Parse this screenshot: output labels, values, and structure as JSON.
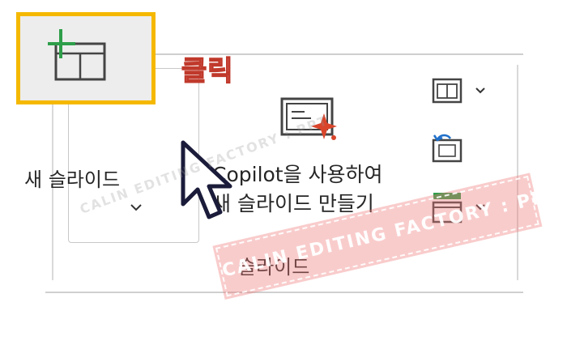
{
  "ribbon": {
    "group_label": "슬라이드",
    "new_slide": {
      "label": "새 슬라이드",
      "icon": "new-slide-icon",
      "chevron": "chevron-down-icon"
    },
    "copilot": {
      "line1": "Copilot을 사용하여",
      "line2": "새 슬라이드 만들기",
      "icon": "copilot-slide-icon"
    },
    "small_buttons": [
      {
        "icon": "layout-icon",
        "has_dropdown": true
      },
      {
        "icon": "reset-icon",
        "has_dropdown": false
      },
      {
        "icon": "section-icon",
        "has_dropdown": true
      }
    ]
  },
  "annotation": {
    "callout": "클릭"
  },
  "watermarks": {
    "main": "CALIN EDITING FACTORY : PPT",
    "faint": "CALIN EDITING FACTORY : PPT"
  },
  "colors": {
    "highlight": "#f5b800",
    "plus_green": "#2e9e4a",
    "copilot_star": "#d9452b",
    "callout": "#f2a6a6",
    "watermark": "#ee7878"
  }
}
